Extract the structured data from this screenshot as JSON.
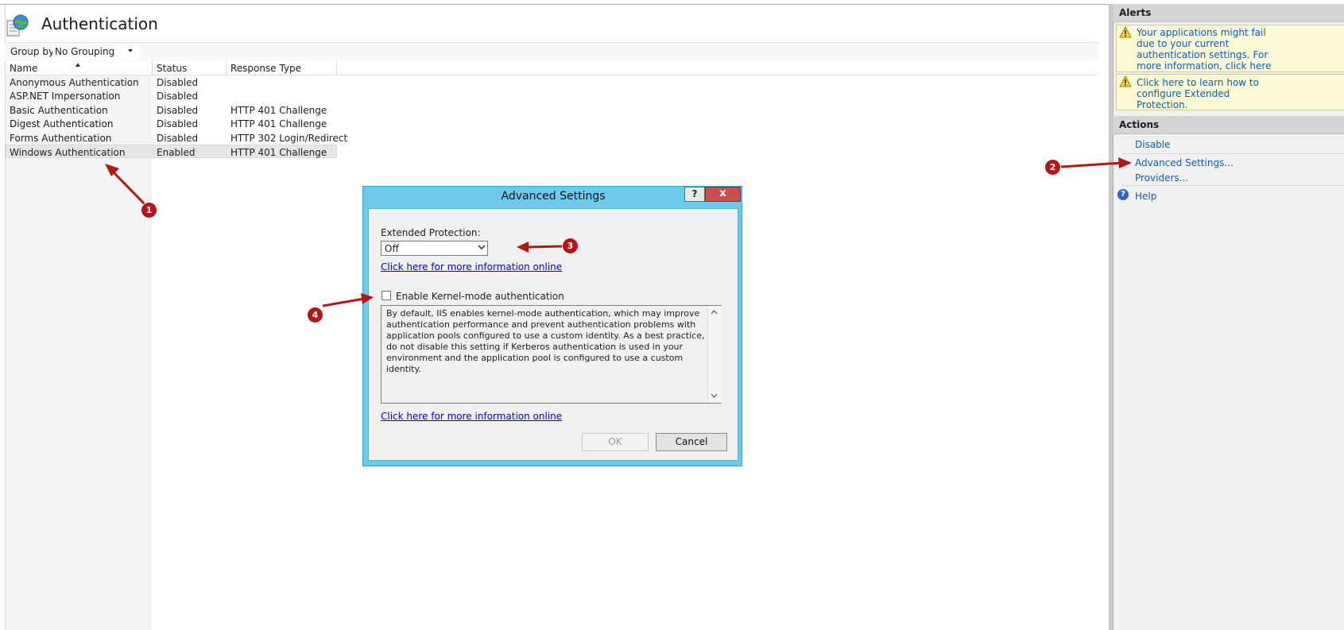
{
  "page": {
    "title": "Authentication",
    "group_by_label": "Group by:",
    "group_by_value": "No Grouping"
  },
  "table": {
    "columns": [
      "Name",
      "Status",
      "Response Type"
    ],
    "rows": [
      {
        "name": "Anonymous Authentication",
        "status": "Disabled",
        "response": ""
      },
      {
        "name": "ASP.NET Impersonation",
        "status": "Disabled",
        "response": ""
      },
      {
        "name": "Basic Authentication",
        "status": "Disabled",
        "response": "HTTP 401 Challenge"
      },
      {
        "name": "Digest Authentication",
        "status": "Disabled",
        "response": "HTTP 401 Challenge"
      },
      {
        "name": "Forms Authentication",
        "status": "Disabled",
        "response": "HTTP 302 Login/Redirect"
      },
      {
        "name": "Windows Authentication",
        "status": "Enabled",
        "response": "HTTP 401 Challenge"
      }
    ]
  },
  "alerts": {
    "title": "Alerts",
    "items": [
      {
        "lines": [
          "Your applications might fail",
          "due to your current",
          "authentication settings.  For",
          "more information, click here"
        ]
      },
      {
        "lines": [
          "Click here to learn how to",
          "configure Extended",
          "Protection."
        ]
      }
    ]
  },
  "actions": {
    "title": "Actions",
    "disable": "Disable",
    "advanced": "Advanced Settings...",
    "providers": "Providers...",
    "help": "Help",
    "help_glyph": "?"
  },
  "dialog": {
    "title": "Advanced Settings",
    "help_glyph": "?",
    "close_glyph": "x",
    "ext_label": "Extended Protection:",
    "ext_value": "Off",
    "info_link": "Click here for more information online",
    "kernel_label": "Enable Kernel-mode authentication",
    "kernel_checked": false,
    "description": "By default, IIS enables kernel-mode authentication, which may improve authentication performance and prevent authentication problems with application pools configured to use a custom identity. As a best practice, do not disable this setting if Kerberos authentication is used in your environment and the application pool is configured to use a custom identity.",
    "info_link_2": "Click here for more information online",
    "ok": "OK",
    "cancel": "Cancel"
  },
  "callouts": [
    "1",
    "2",
    "3",
    "4"
  ],
  "colors": {
    "dialog_frame": "#6dcaea",
    "close_button": "#c75050",
    "link": "#0a5cb8",
    "alert_bg": "#fcfbd5",
    "callout": "#b31616"
  },
  "icons": [
    "globe-icon",
    "warning-icon",
    "help-icon",
    "chevron-down-icon",
    "sort-up-icon"
  ]
}
